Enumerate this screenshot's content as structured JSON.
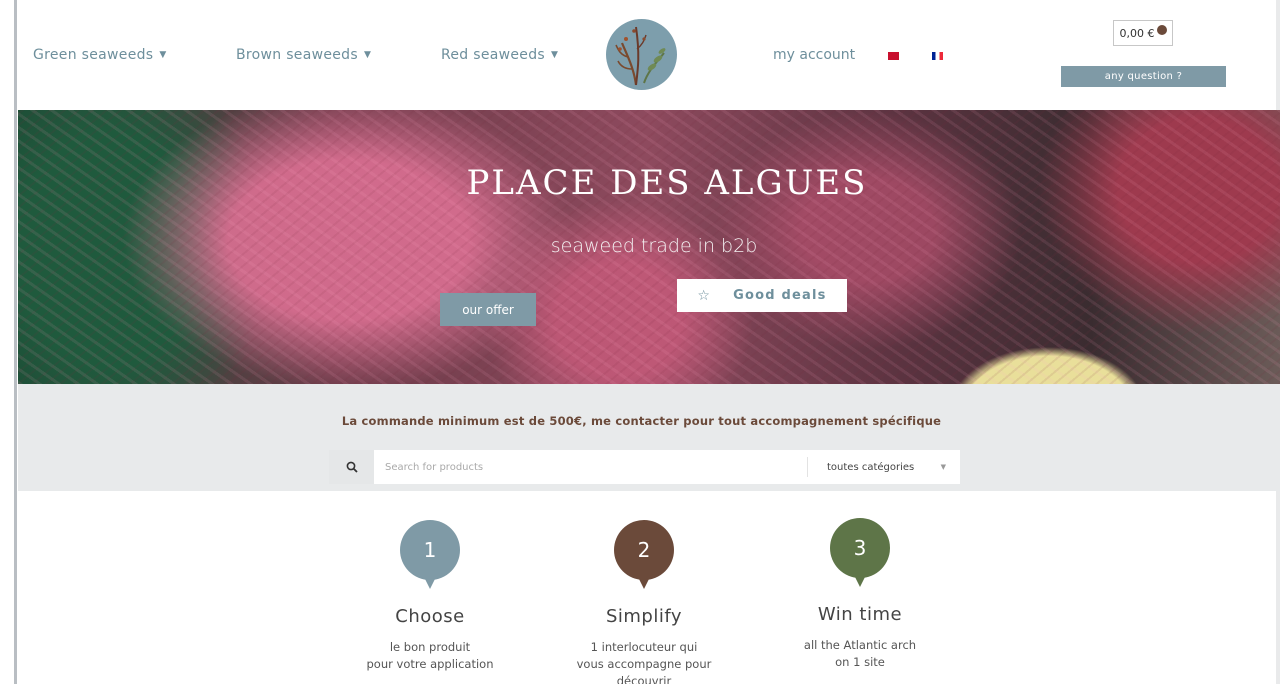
{
  "nav": {
    "green": "Green seaweeds",
    "brown": "Brown seaweeds",
    "red": "Red seaweeds",
    "account": "my account"
  },
  "cart": {
    "amount": "0,00 €"
  },
  "question_button": "any question ?",
  "hero": {
    "title": "PLACE DES ALGUES",
    "subtitle": "seaweed trade in b2b",
    "offer_button": "our offer",
    "deals_button": "Good deals"
  },
  "band": {
    "notice": "La commande minimum est de 500€, me contacter pour tout accompagnement spécifique",
    "search_placeholder": "Search for products",
    "category": "toutes catégories"
  },
  "steps": [
    {
      "number": "1",
      "title": "Choose",
      "line1": "le bon produit",
      "line2": "pour votre application",
      "color": "#7f9aa6"
    },
    {
      "number": "2",
      "title": "Simplify",
      "line1": "1 interlocuteur qui",
      "line2": "vous accompagne pour",
      "line3": "découvrir",
      "color": "#6b4a3a"
    },
    {
      "number": "3",
      "title": "Win time",
      "line1": "all the Atlantic arch",
      "line2": "on 1 site",
      "color": "#5e7548"
    }
  ],
  "colors": {
    "accent": "#7f9aa6",
    "brown": "#6b4a3a",
    "green": "#5e7548",
    "nav_text": "#6e8f9c"
  },
  "icons": [
    "caret-down-icon",
    "flag-en-icon",
    "flag-fr-icon",
    "bag-icon",
    "star-icon",
    "search-icon",
    "seaweed-logo"
  ]
}
